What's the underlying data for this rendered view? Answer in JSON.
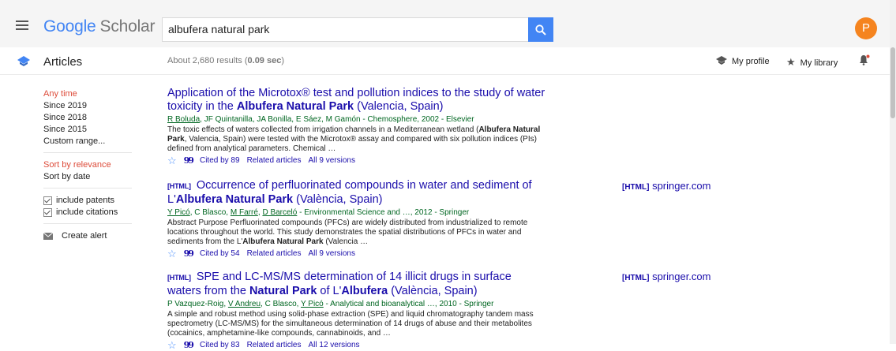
{
  "header": {
    "logo_primary": "Google",
    "logo_secondary": "Scholar",
    "search_value": "albufera natural park",
    "avatar_letter": "P"
  },
  "subheader": {
    "section_title": "Articles",
    "results_prefix": "About 2,680 results (",
    "results_time": "0.09 sec",
    "results_suffix": ")",
    "my_profile": "My profile",
    "my_library": "My library"
  },
  "sidebar": {
    "time_filters": [
      "Any time",
      "Since 2019",
      "Since 2018",
      "Since 2015",
      "Custom range..."
    ],
    "sort_options": [
      "Sort by relevance",
      "Sort by date"
    ],
    "include_patents": "include patents",
    "include_citations": "include citations",
    "create_alert": "Create alert"
  },
  "colors": {
    "accent": "#4285f4",
    "link": "#1a0dab",
    "author_green": "#006621",
    "active_red": "#dd4b39",
    "avatar": "#f5841f"
  },
  "results": [
    {
      "title_part1": "Application of the Microtox® test and pollution indices to the study of water toxicity in the ",
      "title_bold": "Albufera Natural Park",
      "title_part2": " (Valencia, Spain)",
      "authors_link": "R Boluda",
      "authors_rest": ", JF Quintanilla, JA Bonilla, E Sáez, M Gamón - Chemosphere, 2002 - Elsevier",
      "snippet_part1": "The toxic effects of waters collected from irrigation channels in a Mediterranean wetland (",
      "snippet_bold": "Albufera Natural Park",
      "snippet_part2": ", Valencia, Spain) were tested with the Microtox® assay and compared with six pollution indices (PIs) defined from analytical parameters. Chemical …",
      "cited_by": "Cited by 89",
      "related": "Related articles",
      "versions": "All 9 versions"
    },
    {
      "tag": "[HTML]",
      "title_part1": " Occurrence of perfluorinated compounds in water and sediment of L'",
      "title_bold": "Albufera Natural Park",
      "title_part2": " (València, Spain)",
      "authors_html": "<u>Y Picó</u>, C Blasco, <u>M Farré</u>, <u>D Barceló</u> - Environmental Science and …, 2012 - Springer",
      "snippet_part1": "Abstract Purpose Perfluorinated compounds (PFCs) are widely distributed from industrialized to remote locations throughout the world. This study demonstrates the spatial distributions of PFCs in water and sediments from the L'",
      "snippet_bold": "Albufera Natural Park",
      "snippet_part2": " (Valencia …",
      "cited_by": "Cited by 54",
      "related": "Related articles",
      "versions": "All 9 versions",
      "side_tag": "[HTML]",
      "side_source": "springer.com"
    },
    {
      "tag": "[HTML]",
      "title_part1": " SPE and LC-MS/MS determination of 14 illicit drugs in surface waters from the ",
      "title_bold": "Natural Park",
      "title_part2": " of L'",
      "title_bold2": "Albufera",
      "title_part3": " (València, Spain)",
      "authors_html": "P Vazquez-Roig, <u>V Andreu</u>, C Blasco, <u>Y Picó</u> - Analytical and bioanalytical …, 2010 - Springer",
      "snippet": "A simple and robust method using solid-phase extraction (SPE) and liquid chromatography tandem mass spectrometry (LC-MS/MS) for the simultaneous determination of 14 drugs of abuse and their metabolites (cocainics, amphetamine-like compounds, cannabinoids, and …",
      "cited_by": "Cited by 83",
      "related": "Related articles",
      "versions": "All 12 versions",
      "side_tag": "[HTML]",
      "side_source": "springer.com"
    }
  ]
}
